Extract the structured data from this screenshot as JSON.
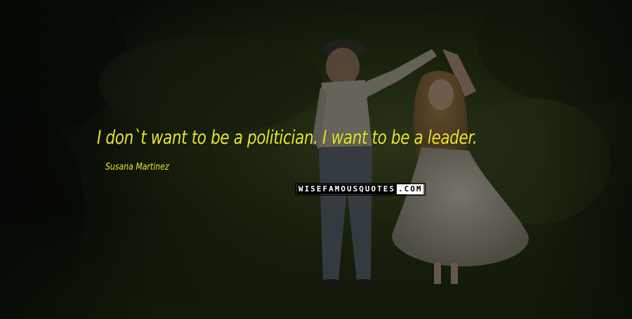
{
  "quote": {
    "text": "I don`t want to be a politician. I want to be a leader.",
    "author": "Susana Martinez"
  },
  "watermark": {
    "dark_part": "WISEFAMOUSQUOTES",
    "light_part": ".COM"
  },
  "colors": {
    "quote_text": "#e9e62a",
    "author_text": "#e9e62a",
    "background_dark": "#121a0e"
  }
}
